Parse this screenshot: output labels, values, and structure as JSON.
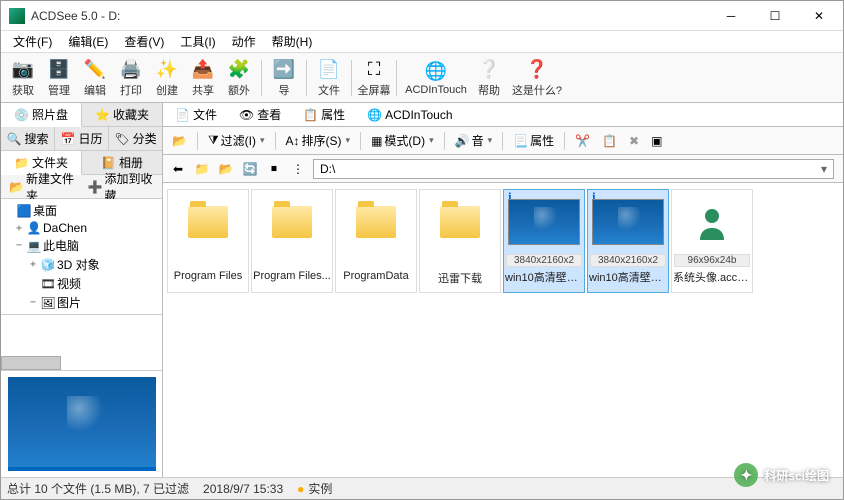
{
  "window": {
    "title": "ACDSee 5.0 - D:"
  },
  "menu": {
    "file": "文件(F)",
    "edit": "编辑(E)",
    "view": "查看(V)",
    "tools": "工具(I)",
    "actions": "动作",
    "help": "帮助(H)"
  },
  "toolbar": {
    "acquire": "获取",
    "manage": "管理",
    "edit": "编辑",
    "print": "打印",
    "create": "创建",
    "share": "共享",
    "extras": "额外",
    "nav": "导",
    "files": "文件",
    "fullscreen": "全屏幕",
    "intouch": "ACDInTouch",
    "help": "帮助",
    "whatis": "这是什么?"
  },
  "side": {
    "tabs1": {
      "photodisk": "照片盘",
      "favorites": "收藏夹"
    },
    "tabs2": {
      "search": "搜索",
      "calendar": "日历",
      "category": "分类"
    },
    "tabs3": {
      "folders": "文件夹",
      "albums": "相册"
    },
    "tools": {
      "newfolder": "新建文件夹",
      "addfav": "添加到收藏"
    },
    "tree": {
      "desktop": "桌面",
      "dachen": "DaChen",
      "thispc": "此电脑",
      "obj3d": "3D 对象",
      "video": "视频",
      "pictures": "图片"
    }
  },
  "viewtabs": {
    "file": "文件",
    "view": "查看",
    "properties": "属性",
    "intouch": "ACDInTouch"
  },
  "filter": {
    "filter": "过滤(I)",
    "sort": "排序(S)",
    "mode": "模式(D)",
    "sound": "音",
    "props": "属性"
  },
  "path": {
    "value": "D:\\"
  },
  "items": [
    {
      "type": "folder",
      "name": "Program Files"
    },
    {
      "type": "folder",
      "name": "Program Files..."
    },
    {
      "type": "folder",
      "name": "ProgramData"
    },
    {
      "type": "folder",
      "name": "迅雷下载"
    },
    {
      "type": "image",
      "name": "win10高清壁纸..",
      "dim": "3840x2160x2",
      "sel": true,
      "info": true
    },
    {
      "type": "image",
      "name": "win10高清壁纸..",
      "dim": "3840x2160x2",
      "sel": true,
      "info": true
    },
    {
      "type": "avatar",
      "name": "系统头像.acco...",
      "dim": "96x96x24b"
    }
  ],
  "status": {
    "count": "总计 10 个文件 (1.5 MB), 7 已过滤",
    "time": "2018/9/7 15:33",
    "example": "实例"
  },
  "watermark": {
    "text": "科研sci绘图"
  }
}
